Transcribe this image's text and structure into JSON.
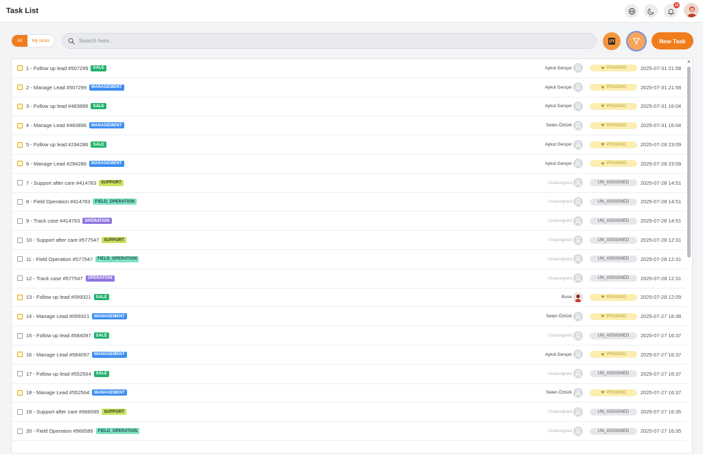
{
  "header": {
    "title": "Task List",
    "icons": [
      "globe-icon",
      "moon-icon",
      "bell-icon"
    ],
    "notification_count": "12"
  },
  "toolbar": {
    "segment_all": "All",
    "segment_mine": "My tasks",
    "search_placeholder": "Search here...",
    "new_task_label": "New Task"
  },
  "colors": {
    "accent": "#f07c1d",
    "sale": "#21b26a",
    "management": "#3d8ef0",
    "support": "#c7e35a",
    "field_operation": "#7fe0c6",
    "operation": "#8f74e0",
    "pending": "#fbeeb0",
    "unassigned": "#e5e7ea"
  },
  "tasks": [
    {
      "title": "1 - Follow up lead #507299",
      "tag": "SALE",
      "assignee": "Aykut Gençer",
      "status": "PENDING",
      "date": "2025-07-31 21:58"
    },
    {
      "title": "2 - Manage Lead #507299",
      "tag": "MANAGEMENT",
      "assignee": "Aykut Gençer",
      "status": "PENDING",
      "date": "2025-07-31 21:58"
    },
    {
      "title": "3 - Follow up lead #483896",
      "tag": "SALE",
      "assignee": "Aykut Gençer",
      "status": "PENDING",
      "date": "2025-07-31 16:04"
    },
    {
      "title": "4 - Manage Lead #483896",
      "tag": "MANAGEMENT",
      "assignee": "Selen Öztürk",
      "status": "PENDING",
      "date": "2025-07-31 16:04"
    },
    {
      "title": "5 - Follow up lead #294286",
      "tag": "SALE",
      "assignee": "Aykut Gençer",
      "status": "PENDING",
      "date": "2025-07-28 23:09"
    },
    {
      "title": "6 - Manage Lead #294286",
      "tag": "MANAGEMENT",
      "assignee": "Aykut Gençer",
      "status": "PENDING",
      "date": "2025-07-28 23:09"
    },
    {
      "title": "7 - Support after care #414783",
      "tag": "SUPPORT",
      "assignee": "Unassigned",
      "status": "UN_ASSIGNED",
      "date": "2025-07-28 14:51"
    },
    {
      "title": "8 - Field Operation #414783",
      "tag": "FIELD_OPERATION",
      "assignee": "Unassigned",
      "status": "UN_ASSIGNED",
      "date": "2025-07-28 14:51"
    },
    {
      "title": "9 - Track case #414783",
      "tag": "OPERATION",
      "assignee": "Unassigned",
      "status": "UN_ASSIGNED",
      "date": "2025-07-28 14:51"
    },
    {
      "title": "10 - Support after care #577547",
      "tag": "SUPPORT",
      "assignee": "Unassigned",
      "status": "UN_ASSIGNED",
      "date": "2025-07-28 12:31"
    },
    {
      "title": "11 - Field Operation #577547",
      "tag": "FIELD_OPERATION",
      "assignee": "Unassigned",
      "status": "UN_ASSIGNED",
      "date": "2025-07-28 12:31"
    },
    {
      "title": "12 - Track case #577547",
      "tag": "OPERATION",
      "assignee": "Unassigned",
      "status": "UN_ASSIGNED",
      "date": "2025-07-28 12:31"
    },
    {
      "title": "13 - Follow up lead #099321",
      "tag": "SALE",
      "assignee": "Buse",
      "status": "PENDING",
      "date": "2025-07-28 12:09",
      "photo": true
    },
    {
      "title": "14 - Manage Lead #099321",
      "tag": "MANAGEMENT",
      "assignee": "Selen Öztürk",
      "status": "PENDING",
      "date": "2025-07-27 16:38"
    },
    {
      "title": "15 - Follow up lead #584097",
      "tag": "SALE",
      "assignee": "Unassigned",
      "status": "UN_ASSIGNED",
      "date": "2025-07-27 16:37"
    },
    {
      "title": "16 - Manage Lead #584097",
      "tag": "MANAGEMENT",
      "assignee": "Aykut Gençer",
      "status": "PENDING",
      "date": "2025-07-27 16:37"
    },
    {
      "title": "17 - Follow up lead #552564",
      "tag": "SALE",
      "assignee": "Unassigned",
      "status": "UN_ASSIGNED",
      "date": "2025-07-27 16:37"
    },
    {
      "title": "18 - Manage Lead #552564",
      "tag": "MANAGEMENT",
      "assignee": "Selen Öztürk",
      "status": "PENDING",
      "date": "2025-07-27 16:37"
    },
    {
      "title": "19 - Support after care #966589",
      "tag": "SUPPORT",
      "assignee": "Unassigned",
      "status": "UN_ASSIGNED",
      "date": "2025-07-27 16:35"
    },
    {
      "title": "20 - Field Operation #966589",
      "tag": "FIELD_OPERATION",
      "assignee": "Unassigned",
      "status": "UN_ASSIGNED",
      "date": "2025-07-27 16:35"
    }
  ]
}
